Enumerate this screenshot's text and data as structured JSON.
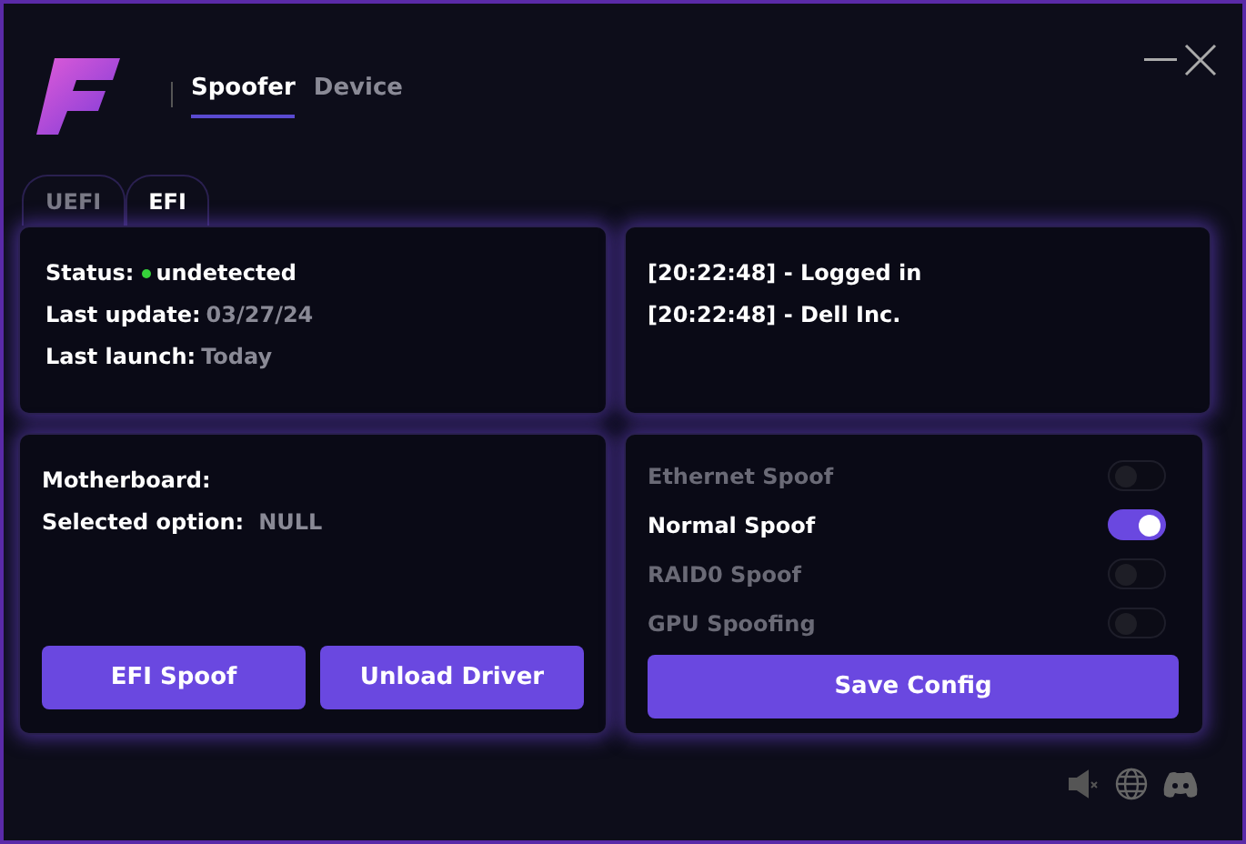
{
  "nav": [
    {
      "label": "Spoofer",
      "selected": true
    },
    {
      "label": "Device",
      "selected": false
    }
  ],
  "tabs": [
    {
      "label": "UEFI",
      "selected": false
    },
    {
      "label": "EFI",
      "selected": true
    }
  ],
  "status": [
    {
      "label": "Status:",
      "value": "undetected",
      "kind": "dot"
    },
    {
      "label": "Last update:",
      "value": "03/27/24",
      "kind": "plain"
    },
    {
      "label": "Last launch:",
      "value": "Today",
      "kind": "plain"
    }
  ],
  "log": [
    "[20:22:48] - Logged in",
    "[20:22:48] - Dell Inc."
  ],
  "board": {
    "motherboard_label": "Motherboard:",
    "option_label": "Selected option:",
    "option_value": "NULL"
  },
  "actions": [
    "EFI Spoof",
    "Unload Driver"
  ],
  "options": [
    {
      "label": "Ethernet Spoof",
      "on": false
    },
    {
      "label": "Normal Spoof",
      "on": true
    },
    {
      "label": "RAID0 Spoof",
      "on": false
    },
    {
      "label": "GPU Spoofing",
      "on": false
    }
  ],
  "save_button": "Save Config"
}
